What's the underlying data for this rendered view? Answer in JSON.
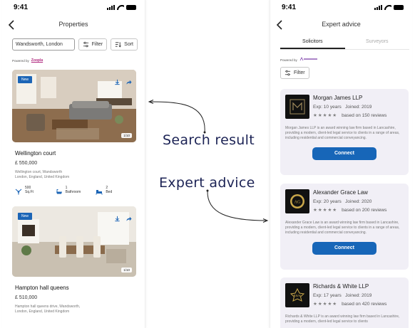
{
  "left": {
    "time": "9:41",
    "title": "Properties",
    "search_value": "Wandsworth, London",
    "filter_label": "Filter",
    "sort_label": "Sort",
    "powered_by": "Powered by",
    "powered_brand": "Zoopla",
    "listings": [
      {
        "badge": "New",
        "counter": "1/10",
        "title": "Wellington court",
        "price": "£ 550,000",
        "address_line1": "Wellington court, Wandsworth",
        "address_line2": "London, England, United Kingdom",
        "area_value": "500",
        "area_unit": "Sq.Ft",
        "bath_value": "1",
        "bath_label": "Bathroom",
        "bed_value": "2",
        "bed_label": "Bed"
      },
      {
        "badge": "New",
        "counter": "1/10",
        "title": "Hampton hall queens",
        "price": "£ 510,000",
        "address_line1": "Hampton hall queens drive, Wandsworth,",
        "address_line2": "London, England, United Kingdom"
      }
    ]
  },
  "annotations": {
    "search_result": "Search result",
    "expert_advice": "Expert advice"
  },
  "right": {
    "time": "9:41",
    "title": "Expert advice",
    "tabs": [
      {
        "label": "Solicitors"
      },
      {
        "label": "Surveyors"
      }
    ],
    "powered_by": "Powered by",
    "filter_label": "Filter",
    "connect_label": "Connect",
    "experts": [
      {
        "name": "Morgan James LLP",
        "experience": "Exp: 10 years",
        "joined": "Joined: 2019",
        "stars": "★★★★★",
        "reviews": "based on 150 reviews",
        "description": "Morgan James LLP is an award winning law firm based in Lancashire, providing a modern, client-led legal service to clients in a range of areas, including residential and commercial conveyancing."
      },
      {
        "name": "Alexander Grace Law",
        "experience": "Exp: 20 years",
        "joined": "Joined: 2020",
        "stars": "★★★★★",
        "reviews": "based on 200 reviews",
        "description": "Alexander Grace Law is an award winning law firm based in Lancashire, providing a modern, client-led legal service to clients in a range of areas, including residential and commercial conveyancing."
      },
      {
        "name": "Richards & White LLP",
        "experience": "Exp: 17 years",
        "joined": "Joined: 2019",
        "stars": "★★★★★",
        "reviews": "based on 420 reviews",
        "description": "Richards & White LLP is an award winning law firm based in Lancashire, providing a modern, client-led legal service to clients"
      }
    ]
  },
  "colors": {
    "accent": "#1766b8",
    "badge": "#1c65b6",
    "annotation": "#1c2355",
    "card_bg": "#f1eff6"
  }
}
